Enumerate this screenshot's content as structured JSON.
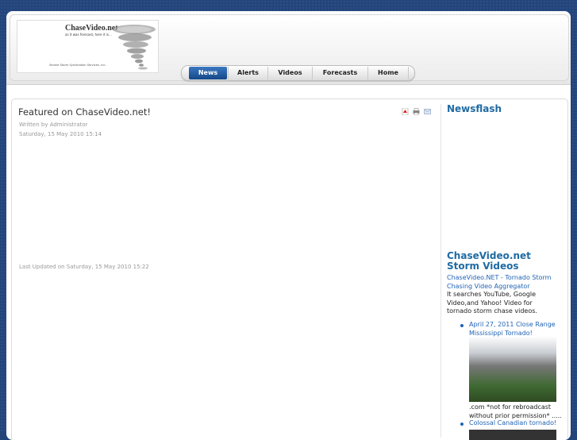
{
  "header": {
    "logo_title": "ChaseVideo.net",
    "logo_tagline": "as it was forecast, here it is...",
    "logo_footer": "Severe Storm Syndication Services, Inc."
  },
  "nav": {
    "items": [
      {
        "label": "News",
        "active": true
      },
      {
        "label": "Alerts",
        "active": false
      },
      {
        "label": "Videos",
        "active": false
      },
      {
        "label": "Forecasts",
        "active": false
      },
      {
        "label": "Home",
        "active": false
      }
    ]
  },
  "article": {
    "title": "Featured on ChaseVideo.net!",
    "author": "Written by Administrator",
    "date": "Saturday, 15 May 2010 15:14",
    "updated": "Last Updated on Saturday, 15 May 2010 15:22",
    "icons": [
      "pdf-icon",
      "print-icon",
      "email-icon"
    ]
  },
  "sidebar": {
    "newsflash_heading": "Newsflash",
    "storm_heading": "ChaseVideo.net Storm Videos",
    "storm_link": "ChaseVideo.NET - Tornado Storm Chasing Video Aggregator",
    "storm_desc": "It searches YouTube, Google Video,and Yahoo! Video for tornado storm chase videos.",
    "videos": [
      {
        "title": "April 27, 2011 Close Range Mississippi Tornado!",
        "caption": ".com *not for rebroadcast without prior permission* ....."
      },
      {
        "title": "Colossal Canadian tornado!"
      }
    ]
  },
  "colors": {
    "background": "#24457a",
    "accent": "#1f6aa3",
    "nav_active": "#1a56a0"
  }
}
